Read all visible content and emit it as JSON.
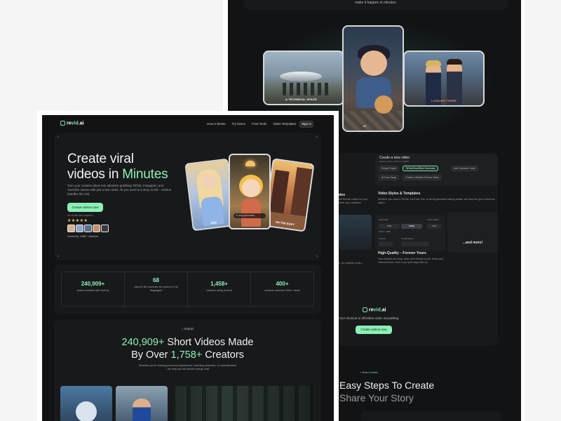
{
  "back": {
    "tagline": "make it happen in minutes.",
    "gallery": [
      {
        "caption": "A TECHNICAL SPACE"
      },
      {
        "caption": "IN"
      },
      {
        "caption": "LOOKING THERE"
      }
    ],
    "create_card": {
      "title": "Create a new video",
      "subtitle": "Select a style or pick a template",
      "chips": [
        "Empty Project",
        "TikTok/Short/Reel Generator",
        "Add Character Voice",
        "AI Face Swap",
        "Create a Website Review Video"
      ]
    },
    "styles": {
      "title": "Video Styles & Templates",
      "desc": "Whether you need a TikTok, YouTube Clip, or an AI-generated talking avatar, we have the go-to select an option."
    },
    "left_strip": {
      "title": "ates",
      "desc": "and female voices for your ideas. your audience."
    },
    "quality": {
      "resolution_label": "Resolution",
      "resolution_options": [
        "720p",
        "1080p"
      ],
      "sub_value": "1920 × 1080",
      "ratio_label": "Frame Ratio",
      "ratio_value": "9:16",
      "format_label": "Format",
      "compression_label": "Compression",
      "title": "High-Quality – Forever Yours",
      "desc": "Your exports are crisp, clear, and entirely yours. Keep your videos forever, even if you part ways with us."
    },
    "left_note": "ry. No complex tools—",
    "more": "...and more!",
    "logo_pre": "re",
    "logo_accent": "vid",
    "logo_post": ".ai",
    "cta_tagline": "Your shortcut to effortless video storytelling",
    "cta_button": "Create videos now",
    "how_badge": "How it works",
    "heading_line1": "Easy Steps To Create",
    "heading_line2": "Share Your Story"
  },
  "front": {
    "nav": {
      "logo_pre": "re",
      "logo_accent": "vid",
      "logo_post": ".ai",
      "links": [
        "How It Works",
        "Try Demo",
        "Free Tools",
        "Video Templates"
      ],
      "signin": "Sign in"
    },
    "hero": {
      "title_line1": "Create viral",
      "title_line2_pre": "videos in ",
      "title_accent": "Minutes",
      "desc": "Turn your creative ideas into attention-grabbing TikTok, Instagram, and YouTube stories with just a few clicks. All you need is a story to tell – revid.ai handles the rest.",
      "cta": "Create videos now",
      "note": "No credit card required",
      "stars": "★★★★★",
      "loved": "Loved by 1458+ creators",
      "card_captions": [
        "AND",
        "",
        "ON THE BUSY"
      ],
      "prompt": "young girl excited"
    },
    "stats": [
      {
        "value": "240,909+",
        "label": "videos created with revid.ai"
      },
      {
        "value": "68",
        "label": "Used in 68 countries for content in 32 languages"
      },
      {
        "value": "1,458+",
        "label": "creators using revid.ai"
      },
      {
        "value": "400+",
        "label": "creators reached 100k+ views"
      }
    ],
    "impact": {
      "badge": "Impact",
      "h2_accent1": "240,909+",
      "h2_mid": " Short Videos Made",
      "h2_line2_pre": "By Over ",
      "h2_accent2": "1,758+",
      "h2_line2_post": " Creators",
      "desc_line1": "Whether you're sharing personal experiences, teaching moments, or entertainment",
      "desc_line2": "– we help you tell stories that go viral."
    }
  }
}
